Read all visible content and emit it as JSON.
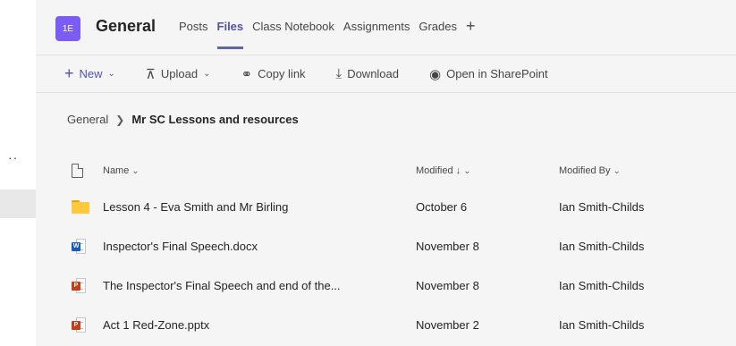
{
  "header": {
    "team_avatar": "1E",
    "channel_name": "General",
    "tabs": [
      {
        "label": "Posts",
        "active": false
      },
      {
        "label": "Files",
        "active": true
      },
      {
        "label": "Class Notebook",
        "active": false
      },
      {
        "label": "Assignments",
        "active": false
      },
      {
        "label": "Grades",
        "active": false
      }
    ],
    "add_tab_icon": "plus-icon"
  },
  "toolbar": {
    "new_label": "New",
    "upload_label": "Upload",
    "copy_link_label": "Copy link",
    "download_label": "Download",
    "sharepoint_label": "Open in SharePoint"
  },
  "left_rail": {
    "ellipsis": "··"
  },
  "breadcrumb": {
    "root": "General",
    "current": "Mr SC Lessons and resources"
  },
  "table": {
    "columns": {
      "name": "Name",
      "modified": "Modified",
      "modified_by": "Modified By"
    },
    "sort": {
      "column": "modified",
      "direction": "descending"
    },
    "rows": [
      {
        "type": "folder",
        "name": "Lesson 4 - Eva Smith and Mr Birling",
        "modified": "October 6",
        "modified_by": "Ian Smith-Childs"
      },
      {
        "type": "word",
        "name": "Inspector's Final Speech.docx",
        "modified": "November 8",
        "modified_by": "Ian Smith-Childs"
      },
      {
        "type": "powerpoint",
        "name": "The Inspector's Final Speech and end of the...",
        "modified": "November 8",
        "modified_by": "Ian Smith-Childs"
      },
      {
        "type": "powerpoint",
        "name": "Act 1 Red-Zone.pptx",
        "modified": "November 2",
        "modified_by": "Ian Smith-Childs"
      }
    ]
  },
  "colors": {
    "accent": "#6264a7",
    "avatar": "#7b5cf5",
    "folder": "#ffc83d",
    "word": "#185abd",
    "powerpoint": "#c43e1c"
  }
}
